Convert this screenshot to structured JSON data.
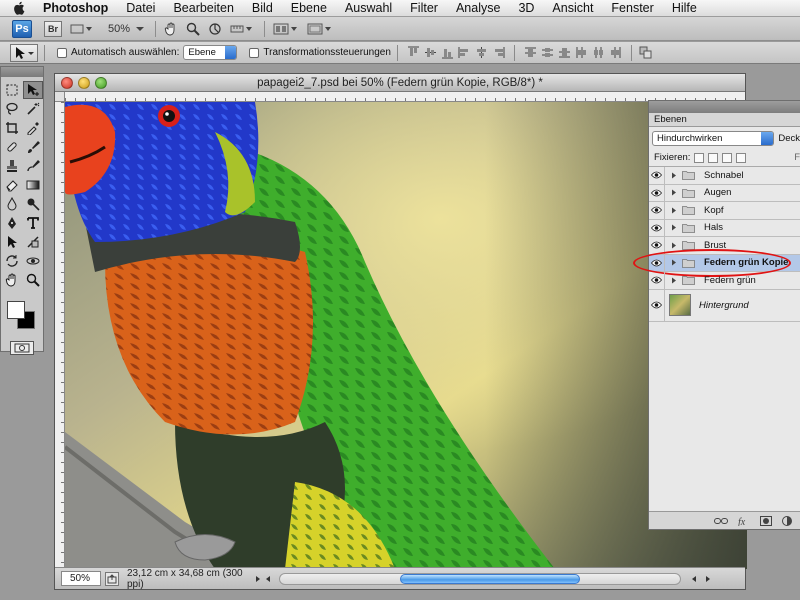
{
  "menubar": {
    "app_name": "Photoshop",
    "menus": [
      "Datei",
      "Bearbeiten",
      "Bild",
      "Ebene",
      "Auswahl",
      "Filter",
      "Analyse",
      "3D",
      "Ansicht",
      "Fenster",
      "Hilfe"
    ]
  },
  "appbar": {
    "ps_label": "Ps",
    "br_label": "Br",
    "zoom": "50%"
  },
  "options": {
    "auto_select_label": "Automatisch auswählen:",
    "auto_select_value": "Ebene",
    "transform_label": "Transformationssteuerungen"
  },
  "document": {
    "title": "papagei2_7.psd bei 50% (Federn grün Kopie, RGB/8*) *",
    "zoom": "50%",
    "info": "23,12 cm x 34,68 cm (300 ppi)"
  },
  "layers_panel": {
    "tab": "Ebenen",
    "blend_mode": "Hindurchwirken",
    "opacity_label": "Deck",
    "lock_label": "Fixieren:",
    "fill_label": "F",
    "layers": [
      {
        "name": "Schnabel",
        "type": "group"
      },
      {
        "name": "Augen",
        "type": "group"
      },
      {
        "name": "Kopf",
        "type": "group"
      },
      {
        "name": "Hals",
        "type": "group"
      },
      {
        "name": "Brust",
        "type": "group"
      },
      {
        "name": "Federn grün Kopie",
        "type": "group",
        "selected": true
      },
      {
        "name": "Federn grün",
        "type": "group"
      },
      {
        "name": "Hintergrund",
        "type": "image"
      }
    ]
  },
  "colors": {
    "highlight": "#e01313",
    "selection": "#b3c8e8",
    "scroll_thumb": "#4a9ae8"
  }
}
